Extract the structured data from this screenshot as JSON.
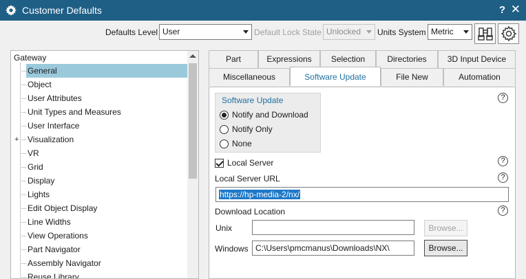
{
  "window": {
    "title": "Customer Defaults",
    "help_glyph": "?",
    "close_glyph": "✕"
  },
  "toolbar": {
    "defaults_level_label": "Defaults Level",
    "defaults_level_value": "User",
    "default_lock_state_label": "Default Lock State",
    "default_lock_state_value": "Unlocked",
    "units_system_label": "Units System",
    "units_system_value": "Metric"
  },
  "tree": {
    "root": "Gateway",
    "items": [
      {
        "label": "General",
        "selected": true
      },
      {
        "label": "Object"
      },
      {
        "label": "User Attributes"
      },
      {
        "label": "Unit Types and Measures"
      },
      {
        "label": "User Interface"
      },
      {
        "label": "Visualization",
        "expandable": true,
        "expander": "+"
      },
      {
        "label": "VR"
      },
      {
        "label": "Grid"
      },
      {
        "label": "Display"
      },
      {
        "label": "Lights"
      },
      {
        "label": "Edit Object Display"
      },
      {
        "label": "Line Widths"
      },
      {
        "label": "View Operations"
      },
      {
        "label": "Part Navigator"
      },
      {
        "label": "Assembly Navigator"
      },
      {
        "label": "Reuse Library"
      }
    ]
  },
  "tabs": {
    "row1": [
      "Part",
      "Expressions",
      "Selection",
      "Directories",
      "3D Input Device"
    ],
    "row2": [
      "Miscellaneous",
      "Software Update",
      "File New",
      "Automation"
    ],
    "active": "Software Update"
  },
  "software_update": {
    "group_title": "Software Update",
    "options": [
      {
        "label": "Notify and Download",
        "selected": true
      },
      {
        "label": "Notify Only",
        "selected": false
      },
      {
        "label": "None",
        "selected": false
      }
    ],
    "local_server_label": "Local Server",
    "local_server_checked": true,
    "local_server_url_label": "Local Server URL",
    "local_server_url_value": "https://hp-media-2/nx/",
    "download_location_label": "Download Location",
    "unix_label": "Unix",
    "unix_value": "",
    "windows_label": "Windows",
    "windows_value": "C:\\Users\\pmcmanus\\Downloads\\NX\\",
    "browse_label": "Browse...",
    "help_glyph": "?"
  }
}
